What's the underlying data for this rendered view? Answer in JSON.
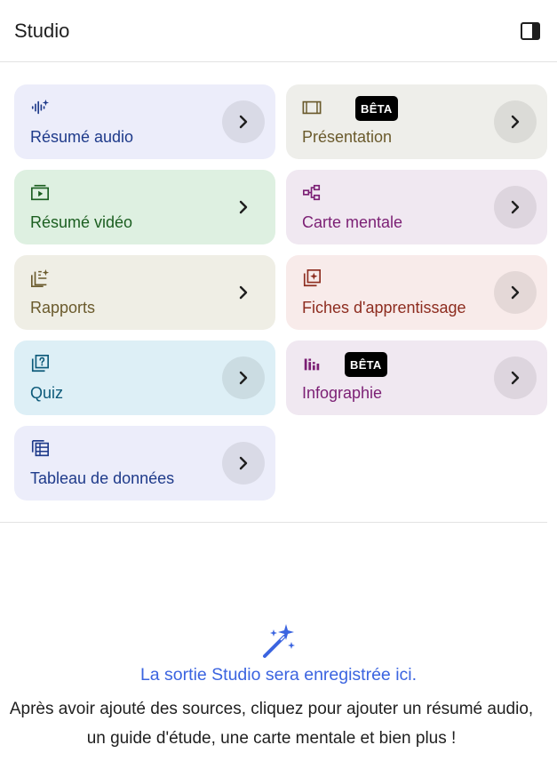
{
  "header": {
    "title": "Studio"
  },
  "cards": {
    "audio": {
      "label": "Résumé audio",
      "bg": "#ecedfa",
      "color": "#1e3a8a"
    },
    "presentation": {
      "label": "Présentation",
      "bg": "#eeeeea",
      "color": "#6a5a2c",
      "badge": "BÊTA"
    },
    "video": {
      "label": "Résumé vidéo",
      "bg": "#def0e1",
      "color": "#1b5e20"
    },
    "mindmap": {
      "label": "Carte mentale",
      "bg": "#f0e8f1",
      "color": "#7b1f74"
    },
    "reports": {
      "label": "Rapports",
      "bg": "#efeee5",
      "color": "#6a5a2c"
    },
    "flashcards": {
      "label": "Fiches d'apprentissage",
      "bg": "#f8ebea",
      "color": "#8d2c1f"
    },
    "quiz": {
      "label": "Quiz",
      "bg": "#ddeff6",
      "color": "#0d5a7a"
    },
    "infographic": {
      "label": "Infographie",
      "bg": "#f0e8f1",
      "color": "#7b1f74",
      "badge": "BÊTA"
    },
    "table": {
      "label": "Tableau de données",
      "bg": "#ecedfa",
      "color": "#1e3a8a"
    }
  },
  "empty_state": {
    "title": "La sortie Studio sera enregistrée ici.",
    "description": "Après avoir ajouté des sources, cliquez pour ajouter un résumé audio, un guide d'étude, une carte mentale et bien plus !"
  },
  "icons": [
    "panel-toggle-icon",
    "audio-waveform-icon",
    "slides-icon",
    "video-icon",
    "mind-map-icon",
    "reports-icon",
    "flashcards-icon",
    "quiz-icon",
    "infographic-icon",
    "table-icon",
    "chevron-right-icon",
    "magic-wand-icon"
  ]
}
